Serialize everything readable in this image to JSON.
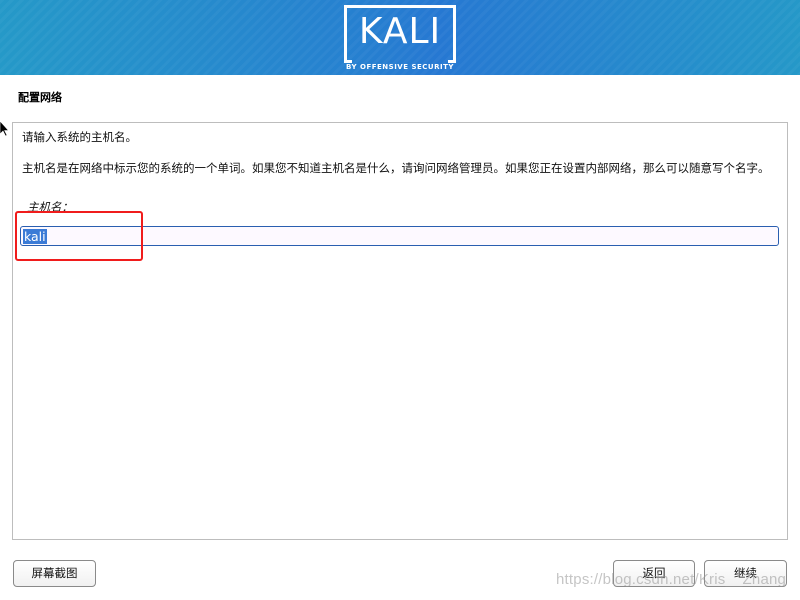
{
  "header": {
    "logo_text": "KALI",
    "logo_subtitle": "BY OFFENSIVE SECURITY"
  },
  "page": {
    "section_title": "配置网络",
    "prompt": "请输入系统的主机名。",
    "description": "主机名是在网络中标示您的系统的一个单词。如果您不知道主机名是什么，请询问网络管理员。如果您正在设置内部网络，那么可以随意写个名字。",
    "field_label": "主机名：",
    "hostname_value": "kali"
  },
  "buttons": {
    "screenshot": "屏幕截图",
    "back": "返回",
    "continue": "继续"
  },
  "watermark": "https://blog.csdn.net/Kris__Zhang",
  "colors": {
    "header_edge": "#2599c8",
    "header_center": "#2678d2",
    "selection": "#3b7bd6",
    "annotation": "#f01c1c",
    "input_border": "#2a5fb0"
  }
}
